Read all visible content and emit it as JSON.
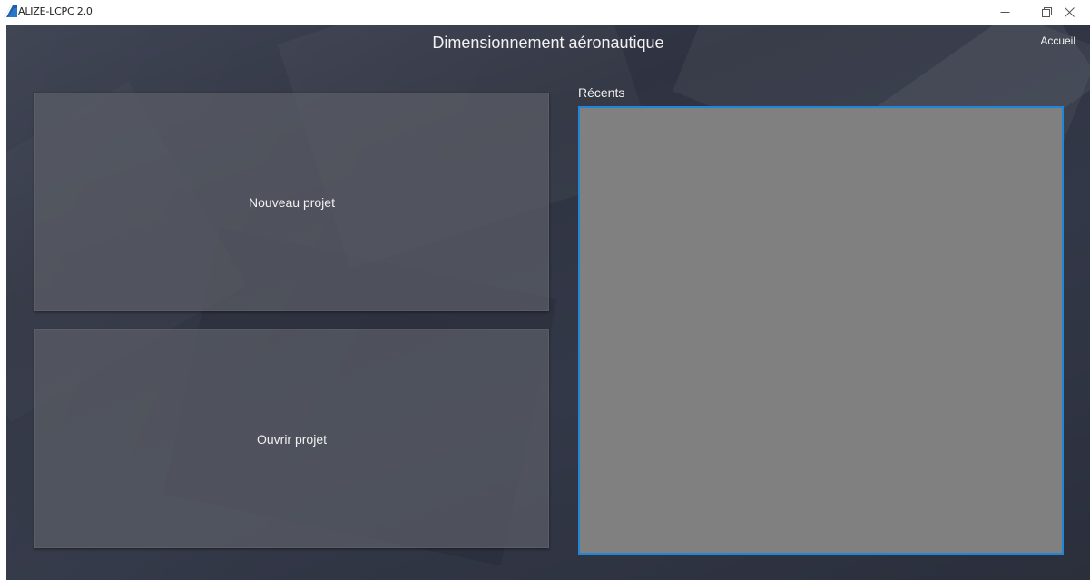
{
  "window": {
    "title": "ALIZE-LCPC 2.0",
    "logo_icon": "alize-logo-icon",
    "controls": {
      "minimize_icon": "minimize-icon",
      "maximize_icon": "restore-icon",
      "close_icon": "close-icon"
    }
  },
  "header": {
    "title": "Dimensionnement aéronautique",
    "home_link": "Accueil"
  },
  "actions": {
    "new_project": "Nouveau projet",
    "open_project": "Ouvrir projet"
  },
  "recents": {
    "label": "Récents",
    "items": []
  },
  "colors": {
    "background": "#31354400",
    "tile": "#5c5e66",
    "recents_bg": "#808080",
    "recents_border": "#1f86d8",
    "text": "#f0f0f0"
  }
}
